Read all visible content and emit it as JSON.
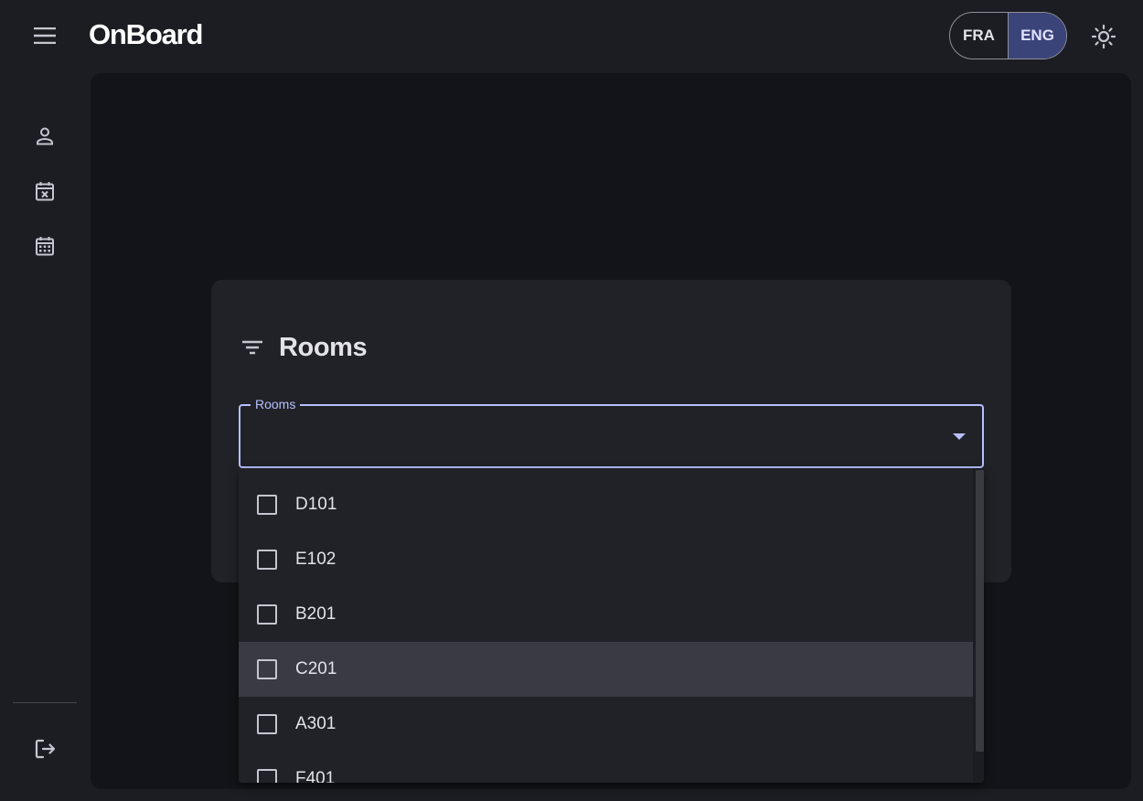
{
  "header": {
    "app_title": "OnBoard",
    "languages": [
      {
        "code": "FRA",
        "selected": false
      },
      {
        "code": "ENG",
        "selected": true
      }
    ],
    "theme_icon": "sun-icon",
    "menu_icon": "hamburger-menu-icon"
  },
  "nav_rail": {
    "items": [
      {
        "icon": "person-icon"
      },
      {
        "icon": "calendar-cancel-icon"
      },
      {
        "icon": "calendar-grid-icon"
      }
    ],
    "logout_icon": "logout-icon"
  },
  "filter_card": {
    "icon": "filter-icon",
    "title": "Rooms",
    "select": {
      "label": "Rooms",
      "value": "",
      "arrow_icon": "dropdown-arrow-icon"
    }
  },
  "rooms_menu": {
    "options": [
      {
        "label": "D101",
        "checked": false
      },
      {
        "label": "E102",
        "checked": false
      },
      {
        "label": "B201",
        "checked": false
      },
      {
        "label": "C201",
        "checked": false,
        "hovered": true
      },
      {
        "label": "A301",
        "checked": false
      },
      {
        "label": "F401",
        "checked": false
      }
    ]
  },
  "colors": {
    "background": "#1c1d22",
    "main_panel": "#131419",
    "card": "#212227",
    "accent": "#b7c0ff",
    "language_selected": "#3b4479",
    "hover_row": "#393a42",
    "text": "#e3e2e8"
  }
}
